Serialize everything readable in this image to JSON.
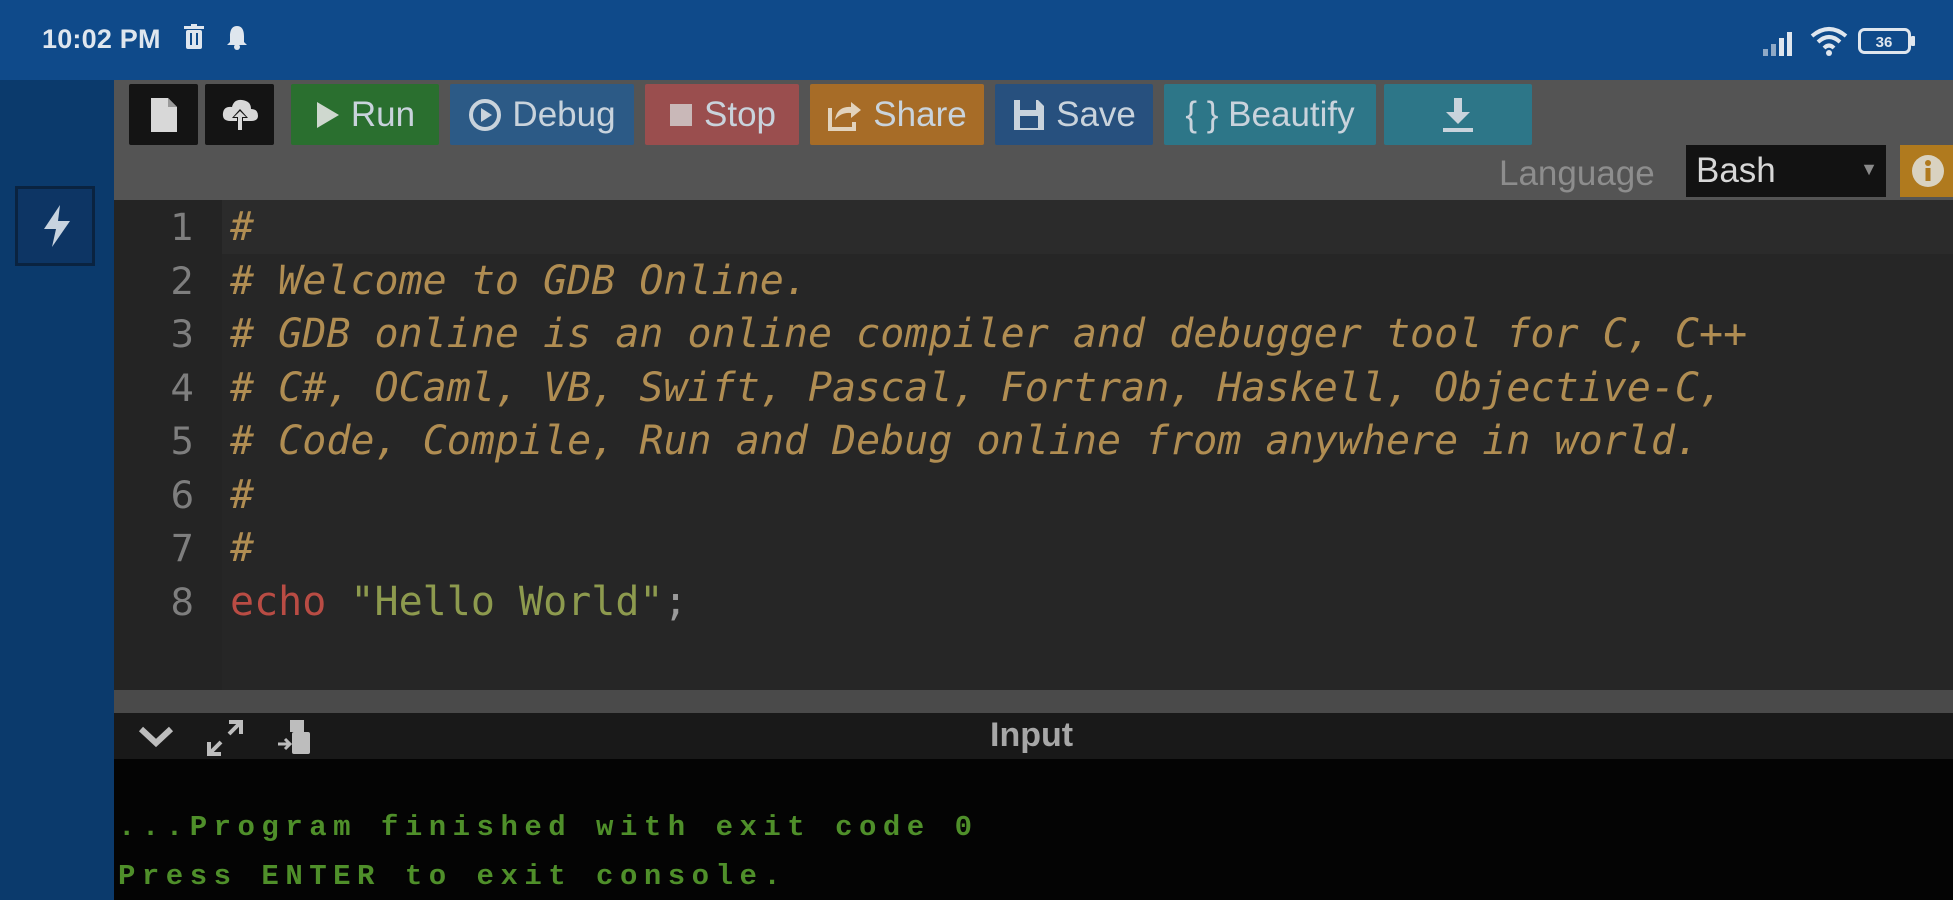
{
  "status_bar": {
    "time": "10:02 PM",
    "left_icons": [
      "trash-icon",
      "bell-icon"
    ],
    "right_icons": [
      "signal-icon",
      "wifi-icon",
      "battery-icon"
    ],
    "battery_level": "36"
  },
  "sidebar": {
    "icon": "lightning-icon"
  },
  "toolbar": {
    "buttons": [
      {
        "name": "new-file",
        "label": "",
        "icon": "file-icon",
        "color": "#141414"
      },
      {
        "name": "upload",
        "label": "",
        "icon": "cloud-upload-icon",
        "color": "#141414"
      },
      {
        "name": "run",
        "label": "Run",
        "icon": "play-icon",
        "color": "#2a6f2f"
      },
      {
        "name": "debug",
        "label": "Debug",
        "icon": "debug-icon",
        "color": "#2c5a86"
      },
      {
        "name": "stop",
        "label": "Stop",
        "icon": "stop-icon",
        "color": "#9a4e4e"
      },
      {
        "name": "share",
        "label": "Share",
        "icon": "share-icon",
        "color": "#a76c27"
      },
      {
        "name": "save",
        "label": "Save",
        "icon": "floppy-icon",
        "color": "#27507e"
      },
      {
        "name": "beautify",
        "label": "{ } Beautify",
        "icon": "",
        "color": "#2d7688"
      },
      {
        "name": "download",
        "label": "",
        "icon": "download-icon",
        "color": "#2d7688"
      }
    ],
    "language_label": "Language",
    "language_value": "Bash"
  },
  "editor": {
    "line_numbers": [
      "1",
      "2",
      "3",
      "4",
      "5",
      "6",
      "7",
      "8"
    ],
    "lines": [
      "#",
      "# Welcome to GDB Online.",
      "# GDB online is an online compiler and debugger tool for C, C++",
      "# C#, OCaml, VB, Swift, Pascal, Fortran, Haskell, Objective-C,",
      "# Code, Compile, Run and Debug online from anywhere in world.",
      "#",
      "#"
    ],
    "line8": {
      "keyword": "echo",
      "string": "\"Hello World\"",
      "punct": ";"
    }
  },
  "io_panel": {
    "title": "Input",
    "icons": [
      "chevron-down-icon",
      "expand-icon",
      "input-cursor-icon"
    ]
  },
  "console": {
    "lines": [
      "...Program finished with exit code 0",
      "Press ENTER to exit console."
    ]
  }
}
